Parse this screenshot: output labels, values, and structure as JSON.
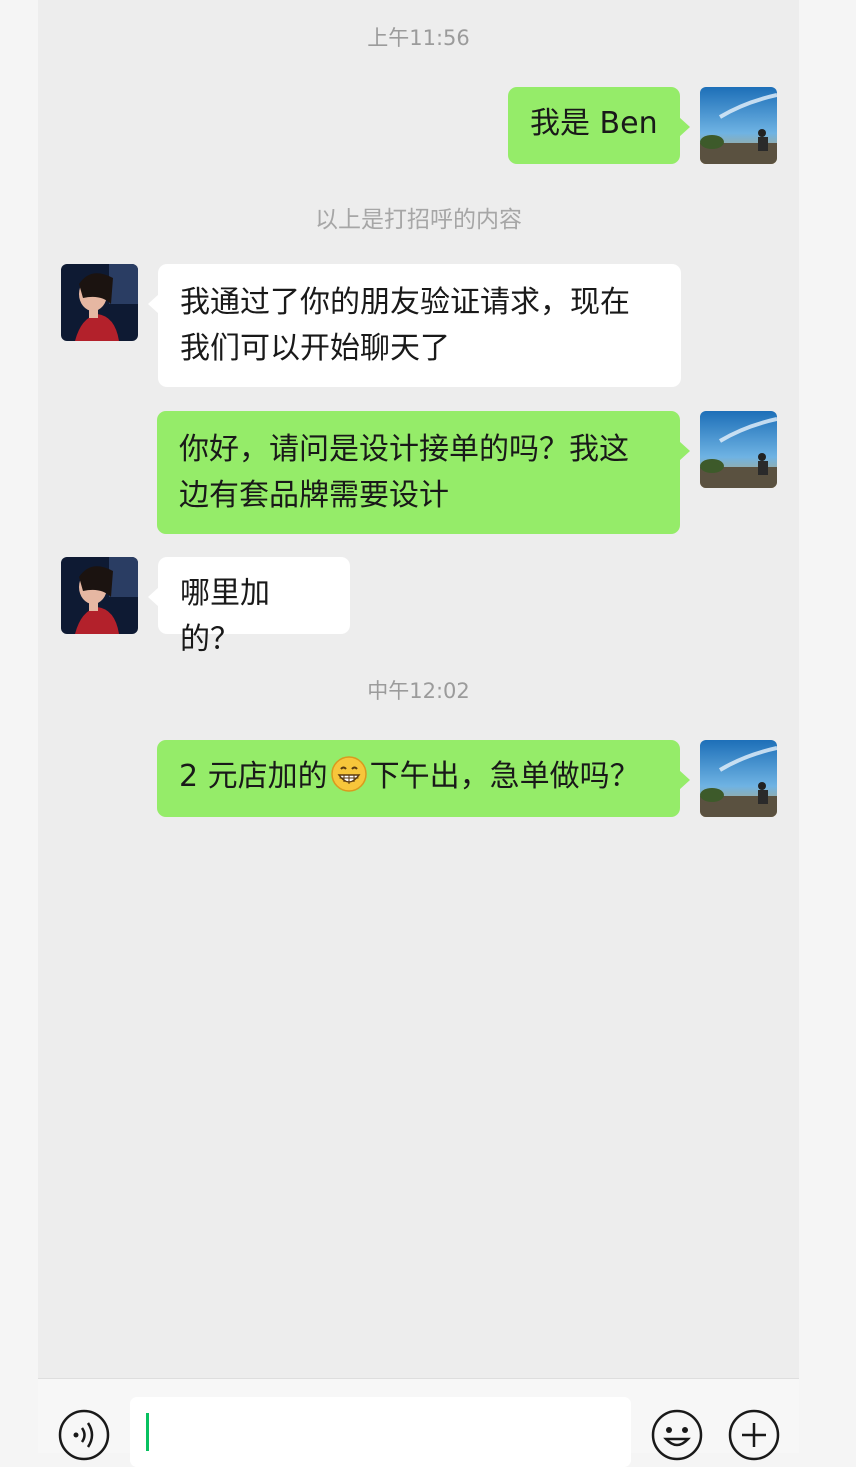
{
  "chat": {
    "timestamps": [
      "上午11:56",
      "中午12:02"
    ],
    "system_notice": "以上是打招呼的内容",
    "messages": [
      {
        "from": "me",
        "text": "我是 Ben"
      },
      {
        "from": "them",
        "lines": [
          "我通过了你的朋友验证请求，现在",
          "我们可以开始聊天了"
        ]
      },
      {
        "from": "me",
        "lines": [
          "你好，请问是设计接单的吗？我这",
          "边有套品牌需要设计"
        ]
      },
      {
        "from": "them",
        "text": "哪里加的？"
      },
      {
        "from": "me",
        "before_emoji": "2 元店加的",
        "emoji": "grinning-face-emoji",
        "after_emoji": "下午出，急单做吗？"
      }
    ]
  },
  "input_bar": {
    "icons": [
      "voice-icon",
      "emoji-icon",
      "plus-icon"
    ],
    "input_value": ""
  },
  "colors": {
    "background": "#ededed",
    "my_bubble": "#95ec69",
    "their_bubble": "#ffffff",
    "cursor": "#07c160"
  }
}
